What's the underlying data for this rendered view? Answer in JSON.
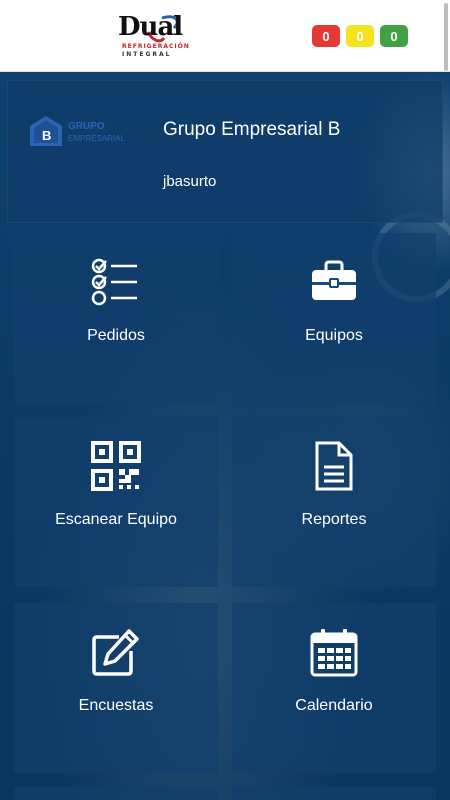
{
  "header": {
    "logo": {
      "main": "Dual",
      "line1": "REFRIGERACIÓN",
      "line2": "INTEGRAL"
    },
    "badges": [
      {
        "value": "0",
        "color": "#e53935"
      },
      {
        "value": "0",
        "color": "#f4e31f"
      },
      {
        "value": "0",
        "color": "#43a047"
      }
    ]
  },
  "profile": {
    "logo_text": {
      "line1": "GRUPO",
      "line2": "EMPRESARIAL",
      "letter": "B"
    },
    "company": "Grupo Empresarial B",
    "username": "jbasurto"
  },
  "menu": [
    {
      "label": "Pedidos",
      "icon": "checklist-icon"
    },
    {
      "label": "Equipos",
      "icon": "toolbox-icon"
    },
    {
      "label": "Escanear Equipo",
      "icon": "qr-code-icon"
    },
    {
      "label": "Reportes",
      "icon": "document-icon"
    },
    {
      "label": "Encuestas",
      "icon": "edit-icon"
    },
    {
      "label": "Calendario",
      "icon": "calendar-icon"
    }
  ]
}
